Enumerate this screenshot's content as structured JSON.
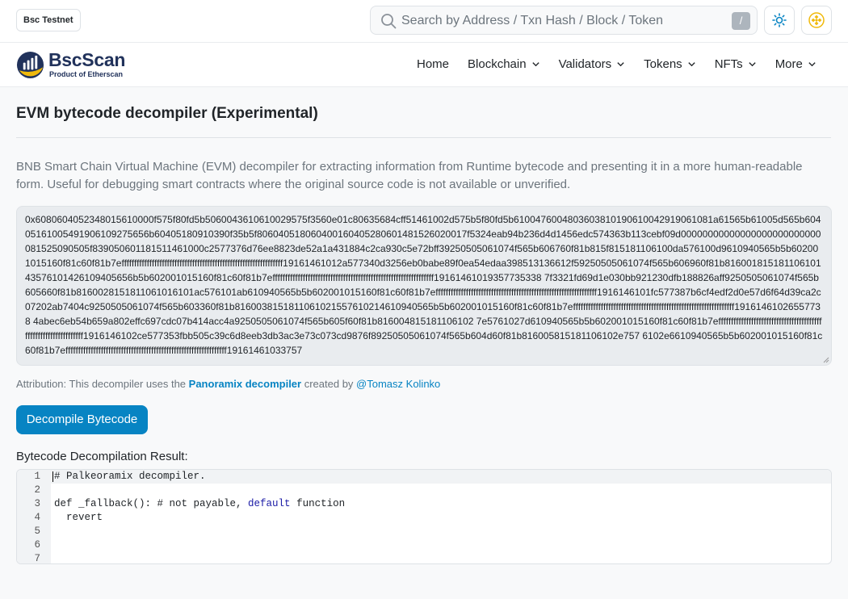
{
  "network_badge": "Bsc Testnet",
  "search": {
    "placeholder": "Search by Address / Txn Hash / Block / Token",
    "shortcut": "/"
  },
  "brand": {
    "name": "BscScan",
    "tagline": "Product of Etherscan",
    "accent": "#f0b90b",
    "dark": "#21325b"
  },
  "nav": {
    "items": [
      {
        "label": "Home",
        "dropdown": false
      },
      {
        "label": "Blockchain",
        "dropdown": true
      },
      {
        "label": "Validators",
        "dropdown": true
      },
      {
        "label": "Tokens",
        "dropdown": true
      },
      {
        "label": "NFTs",
        "dropdown": true
      },
      {
        "label": "More",
        "dropdown": true
      }
    ]
  },
  "page": {
    "title": "EVM bytecode decompiler (Experimental)",
    "description": "BNB Smart Chain Virtual Machine (EVM) decompiler for extracting information from Runtime bytecode and presenting it in a more human-readable form. Useful for debugging smart contracts where the original source code is not available or unverified.",
    "bytecode": "0x6080604052348015610000f575f80fd5b5060043610610029575f3560e01c80635684cff51461002d575b5f80fd5b6100476004803603810190610042919061081a61565b61005d565b60405161005491906109275656b60405180910390f35b5f806040518060400160405280601481526020017f5324eab94b236d4d1456edc574363b113cebf09d00000000000000000000000000081525090505f839050601181511461000c2577376d76ee8823de52a1a431884c2ca930c5e72bff39250505061074f565b606760f81b815f815181106100da576100d9610940565b5b602001015160f81c60f81b7effffffffffffffffffffffffffffffffffffffffffffffffffffffffffffffff19161461012a577340d3256eb0babe89f0ea54edaa398513136612f59250505061074f565b606960f81b81600181518110610143576101426109405656b5b602001015160f81c60f81b7effffffffffffffffffffffffffffffffffffffffffffffffffffffffffffffff19161461019357735338 7f3321fd69d1e030bb921230dfb188826aff9250505061074f565b605660f81b8160028151811061016101ac576101ab610940565b5b602001015160f81c60f81b7effffffffffffffffffffffffffffffffffffffffffffffffffffffffffffffff1916146101fc577387b6cf4edf2d0e57d6f64d39ca2c07202ab7404c9250505061074f565b603360f81b8160038151811061021557610214610940565b5b602001015160f81c60f81b7effffffffffffffffffffffffffffffffffffffffffffffffffffffffffffffff19161461026557738 4abec6eb54b659a802effc697cdc07b414acc4a9250505061074f565b605f60f81b816004815181106102 7e5761027d610940565b5b602001015160f81c60f81b7effffffffffffffffffffffffffffffffffffffffffffffffffffffffffffffff1916146102ce577353fbb505c39c6d8eeb3db3ac3e73c073cd9876f89250505061074f565b604d60f81b816005815181106102e757 6102e6610940565b5b602001015160f81c60f81b7effffffffffffffffffffffffffffffffffffffffffffffffffffffffffffffff19161461033757"
  },
  "attribution": {
    "prefix": "Attribution: This decompiler uses the ",
    "tool": "Panoramix decompiler",
    "middle": " created by ",
    "author": "@Tomasz Kolinko"
  },
  "decompile_button": "Decompile Bytecode",
  "result": {
    "label": "Bytecode Decompilation Result:",
    "lines": [
      {
        "num": "1",
        "text": "# Palkeoramix decompiler."
      },
      {
        "num": "2",
        "text": ""
      },
      {
        "num": "3",
        "pre": "def _fallback(): # not payable, ",
        "kw": "default",
        "post": " function"
      },
      {
        "num": "4",
        "text": "  revert"
      },
      {
        "num": "5",
        "text": ""
      },
      {
        "num": "6",
        "text": ""
      },
      {
        "num": "7",
        "text": ""
      }
    ]
  }
}
